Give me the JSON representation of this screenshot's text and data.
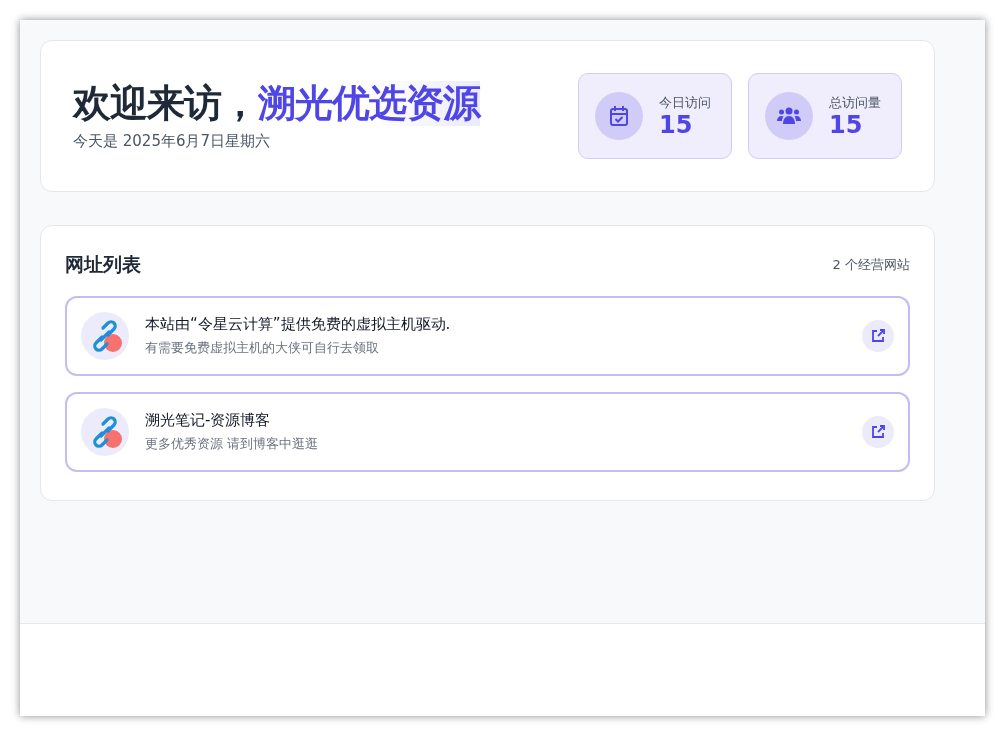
{
  "hero": {
    "greeting": "欢迎来访，",
    "site_name": "溯光优选资源",
    "date_line": "今天是 2025年6月7日星期六"
  },
  "stats": [
    {
      "kind": "calendar",
      "label": "今日访问",
      "value": "15"
    },
    {
      "kind": "users",
      "label": "总访问量",
      "value": "15"
    }
  ],
  "links": {
    "title": "网址列表",
    "count": "2 个经营网站",
    "items": [
      {
        "title": "本站由“令星云计算”提供免费的虚拟主机驱动.",
        "description": "有需要免费虚拟主机的大侠可自行去领取"
      },
      {
        "title": "溯光笔记-资源博客",
        "description": "更多优秀资源 请到博客中逛逛"
      }
    ]
  }
}
